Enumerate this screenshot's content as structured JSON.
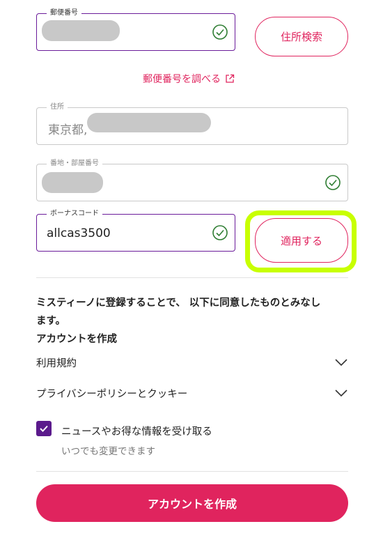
{
  "postal": {
    "label": "郵便番号",
    "search_button": "住所検索",
    "lookup_link": "郵便番号を調べる"
  },
  "address": {
    "label": "住所",
    "value": "東京都,"
  },
  "street": {
    "label": "番地・部屋番号"
  },
  "bonus": {
    "label": "ボーナスコード",
    "value": "allcas3500",
    "apply_button": "適用する"
  },
  "consent": {
    "intro_line1": "ミスティーノに登録することで、 以下に同意したものとみなし",
    "intro_line2": "ます。",
    "heading": "アカウントを作成",
    "terms": "利用規約",
    "privacy": "プライバシーポリシーとクッキー"
  },
  "newsletter": {
    "label": "ニュースやお得な情報を受け取る",
    "note": "いつでも変更できます",
    "checked": true
  },
  "submit": {
    "label": "アカウントを作成"
  },
  "colors": {
    "accent": "#e0245e",
    "active_border": "#6a1b9a",
    "checkbox": "#5b1a8c",
    "highlight": "#c8ff00",
    "valid": "#2e7d32"
  }
}
